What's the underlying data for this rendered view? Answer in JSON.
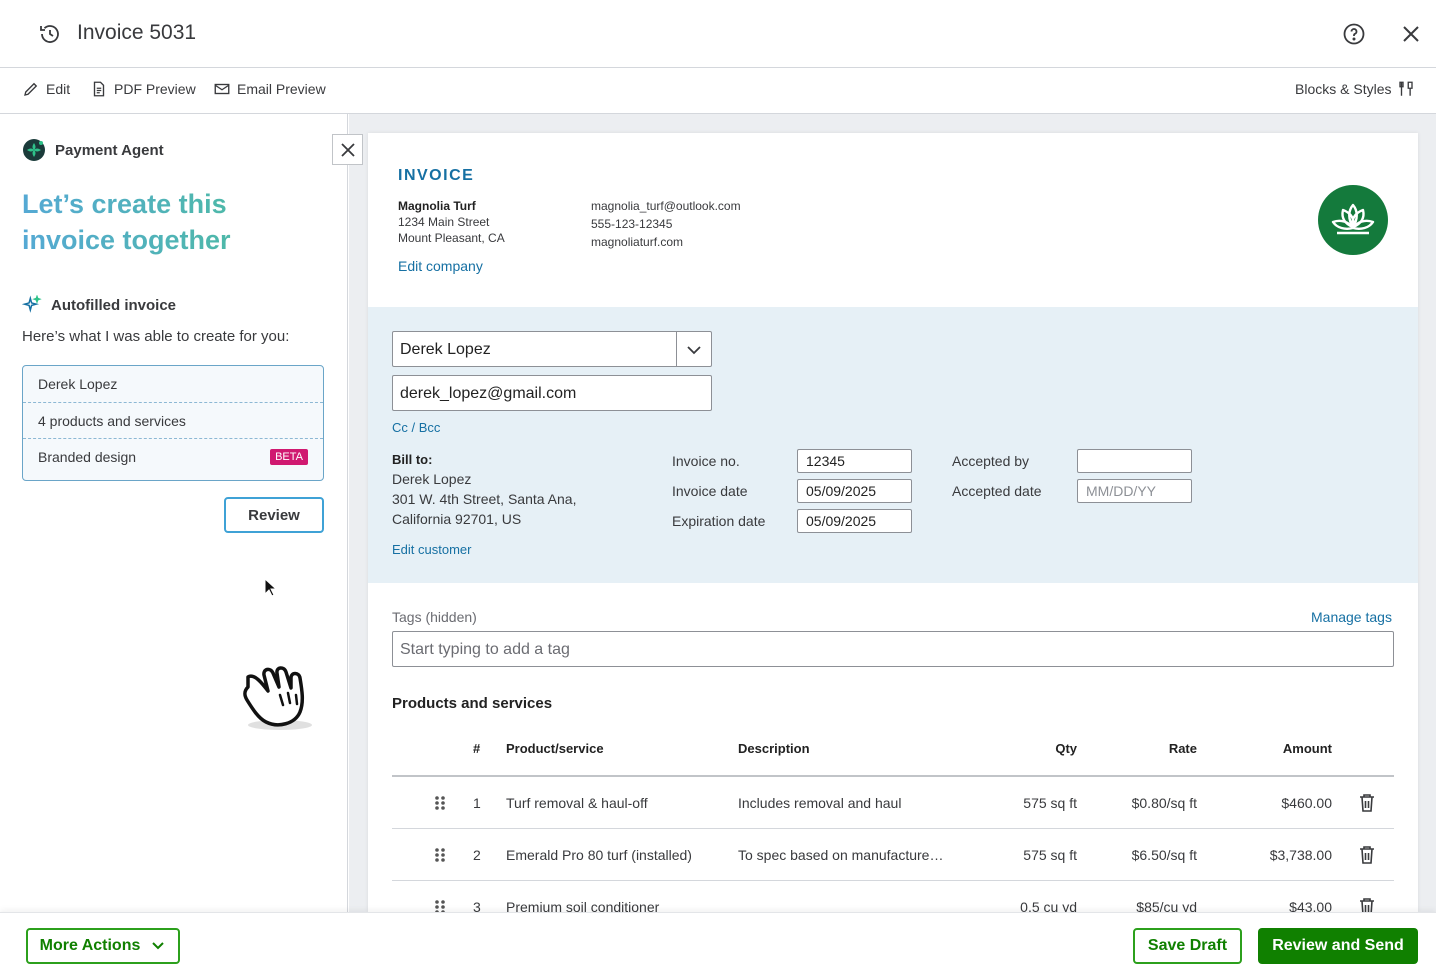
{
  "header": {
    "title": "Invoice 5031",
    "history_icon": "history-icon",
    "help_icon": "help-icon",
    "close_icon": "close-icon"
  },
  "toolbar": {
    "edit": "Edit",
    "pdf_preview": "PDF Preview",
    "email_preview": "Email Preview",
    "blocks_styles": "Blocks & Styles"
  },
  "agent": {
    "name": "Payment Agent",
    "headline": "Let’s create this invoice together",
    "section_title": "Autofilled invoice",
    "intro": "Here’s what I was able to create for you:",
    "summary": [
      {
        "label": "Derek Lopez"
      },
      {
        "label": "4 products and services"
      },
      {
        "label": "Branded design",
        "badge": "BETA"
      }
    ],
    "review_label": "Review"
  },
  "invoice": {
    "heading": "INVOICE",
    "company": {
      "name": "Magnolia Turf",
      "street": "1234 Main Street",
      "city": "Mount Pleasant, CA",
      "email": "magnolia_turf@outlook.com",
      "phone": "555-123-12345",
      "website": "magnoliaturf.com",
      "edit_link": "Edit company"
    },
    "customer": {
      "name": "Derek Lopez",
      "email": "derek_lopez@gmail.com",
      "cc_bcc": "Cc / Bcc",
      "bill_to_label": "Bill to:",
      "bill_name": "Derek Lopez",
      "bill_line1": "301 W. 4th Street, Santa Ana,",
      "bill_line2": "California 92701, US",
      "edit_link": "Edit customer"
    },
    "fields": {
      "invoice_no_label": "Invoice no.",
      "invoice_no": "12345",
      "invoice_date_label": "Invoice date",
      "invoice_date": "05/09/2025",
      "expiration_date_label": "Expiration date",
      "expiration_date": "05/09/2025",
      "accepted_by_label": "Accepted by",
      "accepted_by": "",
      "accepted_date_label": "Accepted date",
      "accepted_date_placeholder": "MM/DD/YY"
    },
    "tags": {
      "label": "Tags (hidden)",
      "manage": "Manage tags",
      "placeholder": "Start typing to add a tag"
    },
    "products": {
      "title": "Products and services",
      "columns": {
        "num": "#",
        "product": "Product/service",
        "description": "Description",
        "qty": "Qty",
        "rate": "Rate",
        "amount": "Amount"
      },
      "rows": [
        {
          "num": "1",
          "product": "Turf removal & haul-off",
          "description": "Includes removal and haul",
          "qty": "575 sq ft",
          "rate": "$0.80/sq ft",
          "amount": "$460.00"
        },
        {
          "num": "2",
          "product": "Emerald Pro 80 turf (installed)",
          "description": "To spec based on manufacture…",
          "qty": "575 sq ft",
          "rate": "$6.50/sq ft",
          "amount": "$3,738.00"
        },
        {
          "num": "3",
          "product": "Premium soil conditioner",
          "description": "",
          "qty": "0.5 cu yd",
          "rate": "$85/cu yd",
          "amount": "$43.00"
        }
      ]
    }
  },
  "footer": {
    "more_actions": "More Actions",
    "save_draft": "Save Draft",
    "review_send": "Review and Send"
  },
  "colors": {
    "brand_green": "#108000",
    "link_blue": "#1670a3",
    "logo_green": "#147a3c",
    "billing_bg": "#e6f0f6"
  }
}
